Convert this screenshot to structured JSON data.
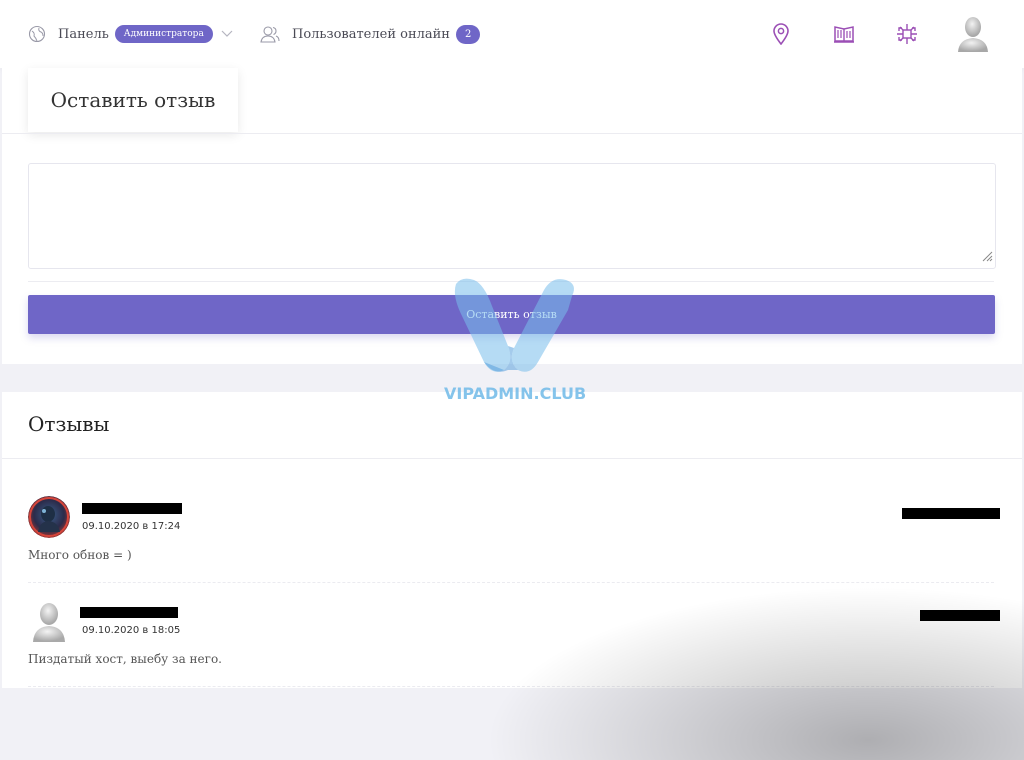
{
  "topbar": {
    "panel_label": "Панель",
    "admin_badge": "Администратора",
    "online_label": "Пользователей онлайн",
    "online_count": "2",
    "icons": [
      "location-pin-icon",
      "book-icon",
      "ornament-icon",
      "user-avatar"
    ]
  },
  "form": {
    "tab_label": "Оставить отзыв",
    "textarea_value": "",
    "submit_label": "Оставить отзыв"
  },
  "reviews": {
    "title": "Отзывы",
    "items": [
      {
        "date": "09.10.2020 в 17:24",
        "text": "Много обнов = )"
      },
      {
        "date": "09.10.2020 в 18:05",
        "text": "Пиздатый хост, выебу за него."
      }
    ]
  },
  "watermark": {
    "text": "VIPADMIN.CLUB"
  },
  "colors": {
    "accent": "#6f66c7",
    "watermark": "#70bae8"
  }
}
